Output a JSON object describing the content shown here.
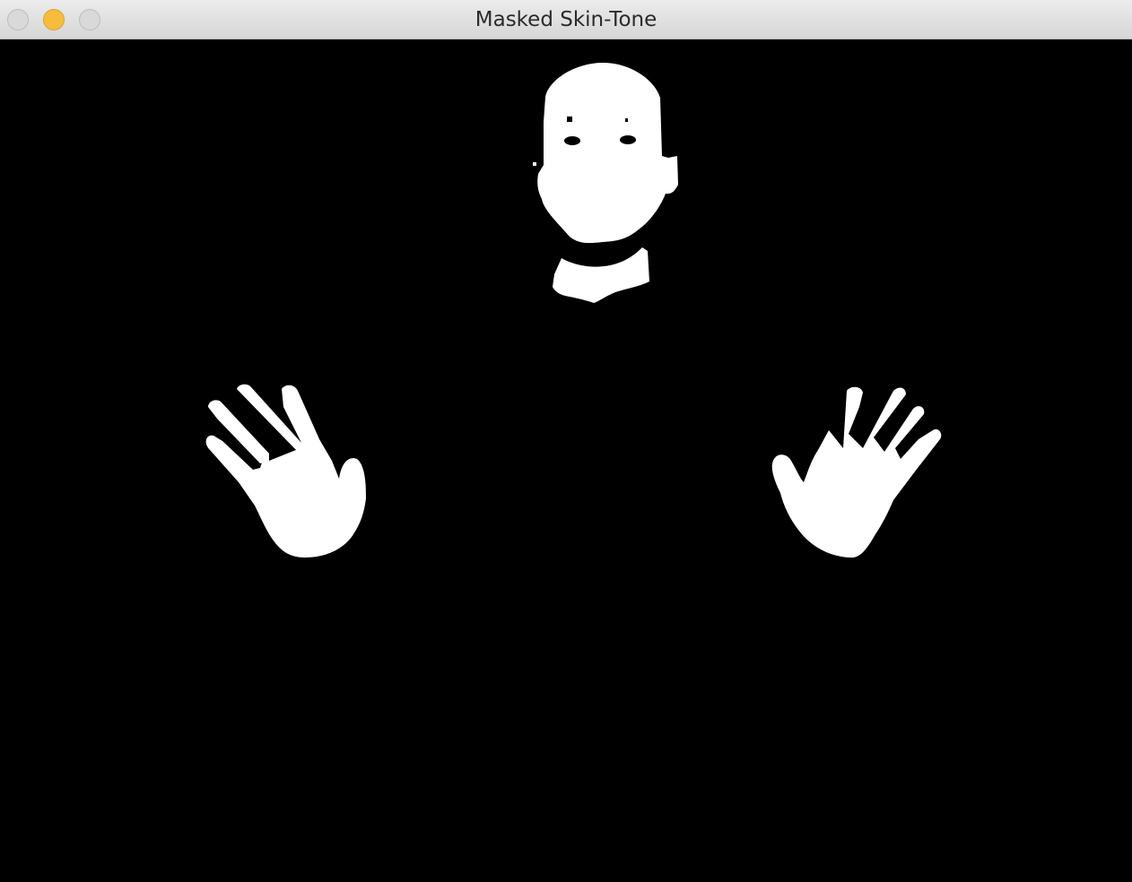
{
  "window": {
    "title": "Masked Skin-Tone"
  },
  "image": {
    "background_color": "#000000",
    "mask_color": "#ffffff",
    "regions": [
      "head",
      "neck",
      "left-hand",
      "right-hand"
    ]
  },
  "icons": {
    "close": "close-button",
    "minimize": "minimize-button",
    "maximize": "maximize-button"
  },
  "colors": {
    "minimize": "#f6bd3c",
    "inactive": "#d9d9d9"
  }
}
